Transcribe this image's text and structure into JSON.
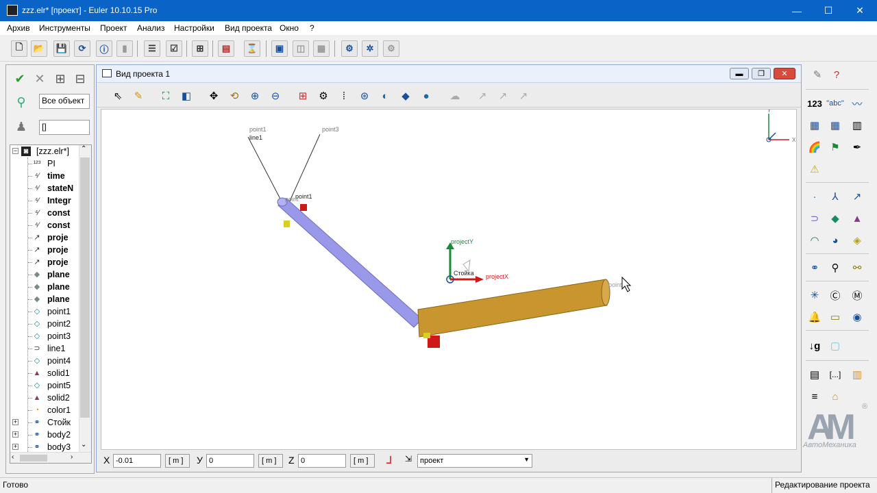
{
  "window": {
    "title": "zzz.elr* [проект] - Euler 10.10.15 Pro",
    "minimize": "—",
    "maximize": "☐",
    "close": "✕"
  },
  "menu": [
    "Архив",
    "Инструменты",
    "Проект",
    "Анализ",
    "Настройки",
    "Вид проекта",
    "Окно",
    "?"
  ],
  "left_panel": {
    "filter_value": "Все объект",
    "selection_value": "[]",
    "tree": [
      {
        "label": "[zzz.elr*]",
        "icon": "project-icon"
      },
      {
        "label": "PI",
        "icon": "number-icon"
      },
      {
        "label": "time",
        "icon": "variable-icon"
      },
      {
        "label": "stateN",
        "icon": "variable-icon"
      },
      {
        "label": "Integr",
        "icon": "variable-icon"
      },
      {
        "label": "const",
        "icon": "variable-icon"
      },
      {
        "label": "const",
        "icon": "variable-icon"
      },
      {
        "label": "proje",
        "icon": "vector-icon"
      },
      {
        "label": "proje",
        "icon": "vector-icon"
      },
      {
        "label": "proje",
        "icon": "vector-icon"
      },
      {
        "label": "plane",
        "icon": "plane-icon"
      },
      {
        "label": "plane",
        "icon": "plane-icon"
      },
      {
        "label": "plane",
        "icon": "plane-icon"
      },
      {
        "label": "point1",
        "icon": "point-icon"
      },
      {
        "label": "point2",
        "icon": "point-icon"
      },
      {
        "label": "point3",
        "icon": "point-icon"
      },
      {
        "label": "line1",
        "icon": "line-icon"
      },
      {
        "label": "point4",
        "icon": "point-icon"
      },
      {
        "label": "solid1",
        "icon": "solid-icon"
      },
      {
        "label": "point5",
        "icon": "point-icon"
      },
      {
        "label": "solid2",
        "icon": "solid-icon"
      },
      {
        "label": "color1",
        "icon": "color-icon"
      },
      {
        "label": "Стойк",
        "icon": "body-icon"
      },
      {
        "label": "body2",
        "icon": "body-icon"
      },
      {
        "label": "body3",
        "icon": "body-icon"
      }
    ]
  },
  "project_view": {
    "title": "Вид проекта 1",
    "scene_labels": {
      "point1_top": "point1",
      "line1": "line1",
      "point3": "point3",
      "point1_mid": "point1",
      "point_small": "point",
      "projectY": "projectY",
      "projectX": "projectX",
      "stoyka": "Стойка",
      "point_right": "point",
      "axis_y": "Y",
      "axis_x": "X"
    },
    "coords": {
      "x_label": "X",
      "x_value": "-0.01",
      "x_unit": "[ m ]",
      "y_label": "У",
      "y_value": "0",
      "y_unit": "[ m ]",
      "z_label": "Z",
      "z_value": "0",
      "z_unit": "[ m ]",
      "frame_value": "проект"
    }
  },
  "logo": {
    "text": "АвтоМеханика",
    "mark": "AM",
    "registered": "®"
  },
  "status": {
    "left": "Готово",
    "right": "Редактирование проекта"
  },
  "colors": {
    "titlebar": "#0a64c8",
    "link1": "#9a98e8",
    "link2": "#c8952e",
    "joint": "#d01818"
  }
}
